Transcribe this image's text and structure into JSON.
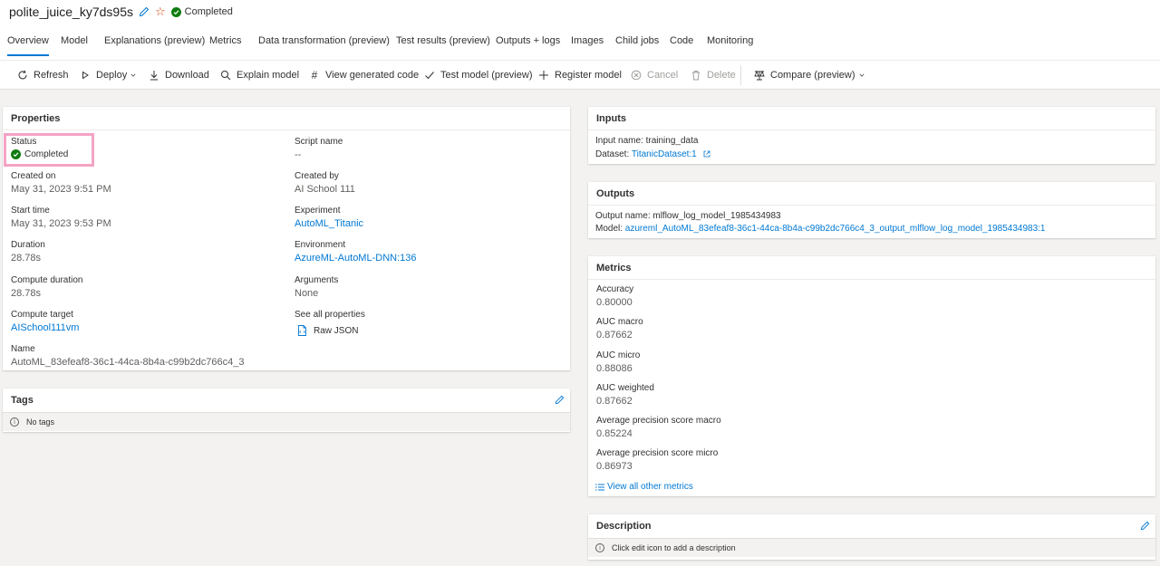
{
  "header": {
    "title": "polite_juice_ky7ds95s",
    "status": "Completed"
  },
  "tabs": [
    {
      "label": "Overview",
      "active": true
    },
    {
      "label": "Model"
    },
    {
      "label": "Explanations (preview)"
    },
    {
      "label": "Metrics"
    },
    {
      "label": "Data transformation (preview)"
    },
    {
      "label": "Test results (preview)"
    },
    {
      "label": "Outputs + logs"
    },
    {
      "label": "Images"
    },
    {
      "label": "Child jobs"
    },
    {
      "label": "Code"
    },
    {
      "label": "Monitoring"
    }
  ],
  "toolbar": {
    "refresh": "Refresh",
    "deploy": "Deploy",
    "download": "Download",
    "explain": "Explain model",
    "view_code": "View generated code",
    "test_model": "Test model (preview)",
    "register": "Register model",
    "cancel": "Cancel",
    "delete": "Delete",
    "compare": "Compare (preview)"
  },
  "properties": {
    "title": "Properties",
    "status_label": "Status",
    "status_value": "Completed",
    "created_on_label": "Created on",
    "created_on_value": "May 31, 2023 9:51 PM",
    "start_time_label": "Start time",
    "start_time_value": "May 31, 2023 9:53 PM",
    "duration_label": "Duration",
    "duration_value": "28.78s",
    "compute_duration_label": "Compute duration",
    "compute_duration_value": "28.78s",
    "compute_target_label": "Compute target",
    "compute_target_value": "AISchool111vm",
    "name_label": "Name",
    "name_value": "AutoML_83efeaf8-36c1-44ca-8b4a-c99b2dc766c4_3",
    "script_name_label": "Script name",
    "script_name_value": "--",
    "created_by_label": "Created by",
    "created_by_value": "AI School 111",
    "experiment_label": "Experiment",
    "experiment_value": "AutoML_Titanic",
    "environment_label": "Environment",
    "environment_value": "AzureML-AutoML-DNN:136",
    "arguments_label": "Arguments",
    "arguments_value": "None",
    "see_all_label": "See all properties",
    "raw_json": "Raw JSON"
  },
  "tags": {
    "title": "Tags",
    "empty": "No tags"
  },
  "inputs": {
    "title": "Inputs",
    "name_line": "Input name: training_data",
    "dataset_prefix": "Dataset:",
    "dataset_link": "TitanicDataset:1"
  },
  "outputs": {
    "title": "Outputs",
    "name_line": "Output name: mlflow_log_model_1985434983",
    "model_prefix": "Model:",
    "model_link": "azureml_AutoML_83efeaf8-36c1-44ca-8b4a-c99b2dc766c4_3_output_mlflow_log_model_1985434983:1"
  },
  "metrics": {
    "title": "Metrics",
    "items": [
      {
        "label": "Accuracy",
        "value": "0.80000"
      },
      {
        "label": "AUC macro",
        "value": "0.87662"
      },
      {
        "label": "AUC micro",
        "value": "0.88086"
      },
      {
        "label": "AUC weighted",
        "value": "0.87662"
      },
      {
        "label": "Average precision score macro",
        "value": "0.85224"
      },
      {
        "label": "Average precision score micro",
        "value": "0.86973"
      }
    ],
    "view_all": "View all other metrics"
  },
  "description": {
    "title": "Description",
    "empty": "Click edit icon to add a description"
  },
  "colors": {
    "accent": "#0078d4",
    "success": "#107c10",
    "highlight": "#f4a3c5"
  }
}
